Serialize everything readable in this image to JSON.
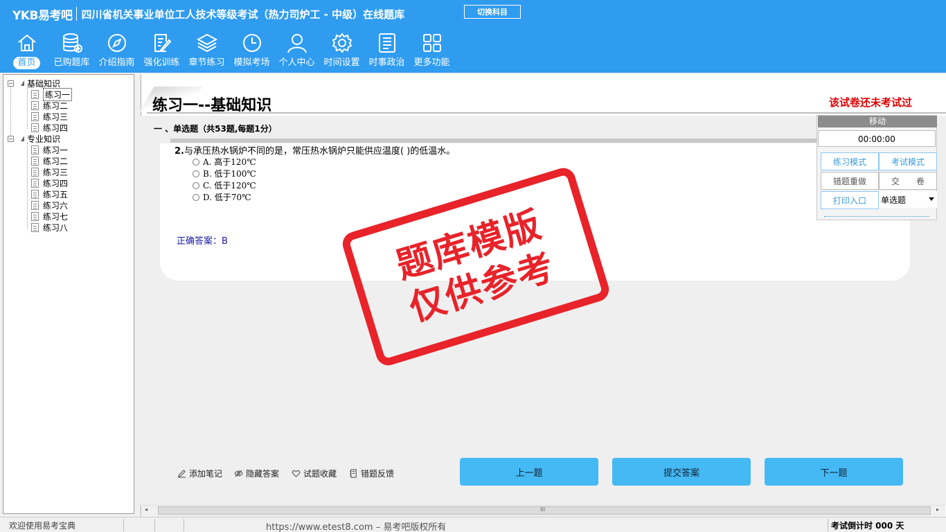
{
  "header": {
    "brand": "YKB易考吧",
    "title": "四川省机关事业单位工人技术等级考试（热力司炉工 - 中级）在线题库",
    "switch_label": "切换科目",
    "nav": [
      {
        "label": "首页",
        "icon": "home-icon"
      },
      {
        "label": "已购题库",
        "icon": "database-icon"
      },
      {
        "label": "介绍指南",
        "icon": "compass-icon"
      },
      {
        "label": "强化训练",
        "icon": "edit-icon"
      },
      {
        "label": "章节练习",
        "icon": "layers-icon"
      },
      {
        "label": "模拟考场",
        "icon": "clock-icon"
      },
      {
        "label": "个人中心",
        "icon": "user-icon"
      },
      {
        "label": "时间设置",
        "icon": "gear-icon"
      },
      {
        "label": "时事政治",
        "icon": "news-icon"
      },
      {
        "label": "更多功能",
        "icon": "grid-icon"
      }
    ]
  },
  "tree": {
    "groups": [
      {
        "label": "基础知识",
        "items": [
          "练习一",
          "练习二",
          "练习三",
          "练习四"
        ]
      },
      {
        "label": "专业知识",
        "items": [
          "练习一",
          "练习二",
          "练习三",
          "练习四",
          "练习五",
          "练习六",
          "练习七",
          "练习八"
        ]
      }
    ],
    "expander": "−"
  },
  "main": {
    "section_title": "练习一--基础知识",
    "status": "该试卷还未考试过",
    "question_type": "一 、单选题（共53题,每题1分）",
    "question": {
      "number": "2.",
      "text": "与承压热水锅炉不同的是，常压热水锅炉只能供应温度( )的低温水。",
      "options": [
        "A. 高于120℃",
        "B. 低于100℃",
        "C. 低于120℃",
        "D. 低于70℃"
      ],
      "answer": "正确答案：B"
    },
    "stamp": [
      "题库模版",
      "仅供参考"
    ]
  },
  "panel": {
    "head": "移动",
    "timer": "00:00:00",
    "practice_mode": "练习模式",
    "exam_mode": "考试模式",
    "redo_wrong": "错题重做",
    "submit_paper": "交　　卷",
    "print": "打印入口",
    "type_select": "单选题"
  },
  "tools": {
    "note": "添加笔记",
    "hide_answer": "隐藏答案",
    "favorite": "试题收藏",
    "feedback": "错题反馈"
  },
  "buttons": {
    "prev": "上一题",
    "submit": "提交答案",
    "next": "下一题"
  },
  "scroll": {
    "grip": "III",
    "left": "◂",
    "right": "▸"
  },
  "statusbar": {
    "welcome": "欢迎使用易考宝典",
    "copyright": "https://www.etest8.com – 易考吧版权所有",
    "countdown": "考试倒计时 000 天"
  },
  "colors": {
    "header": "#2f9cf0",
    "button": "#45b9f4",
    "stamp": "#e8232a",
    "alert": "#dd0000"
  }
}
